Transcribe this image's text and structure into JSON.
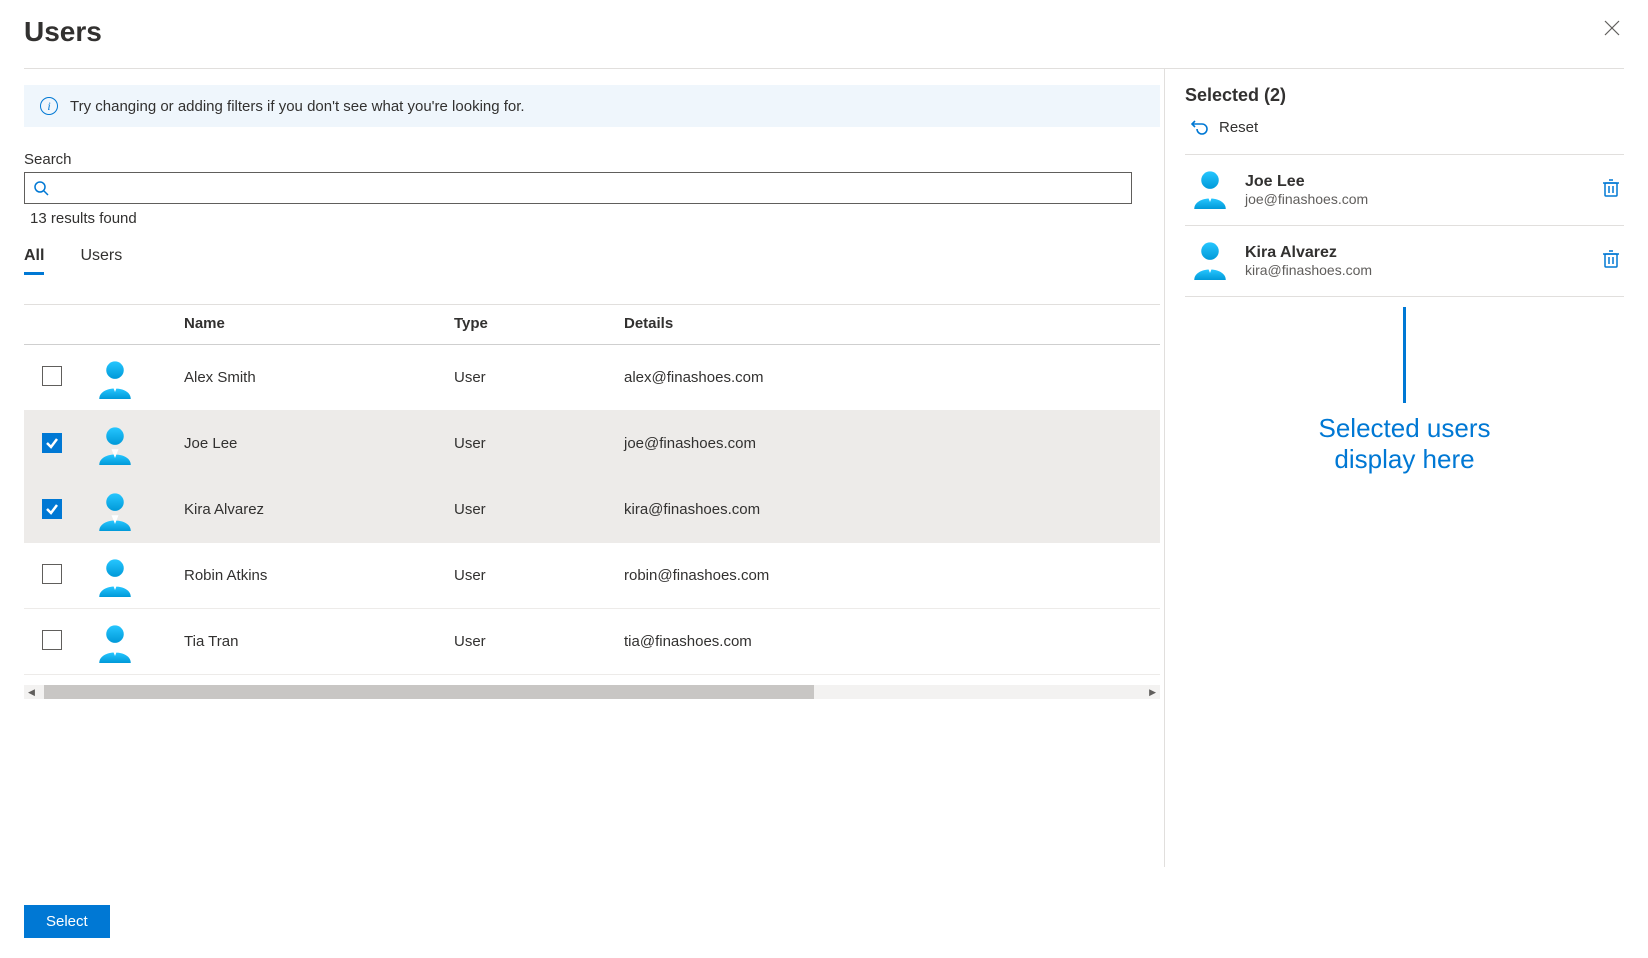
{
  "pageTitle": "Users",
  "infoBanner": "Try changing or adding filters if you don't see what you're looking for.",
  "searchLabel": "Search",
  "resultsCount": "13 results found",
  "tabs": {
    "all": "All",
    "users": "Users"
  },
  "columns": {
    "name": "Name",
    "type": "Type",
    "details": "Details"
  },
  "rows": [
    {
      "name": "Alex Smith",
      "type": "User",
      "details": "alex@finashoes.com",
      "checked": false
    },
    {
      "name": "Joe Lee",
      "type": "User",
      "details": "joe@finashoes.com",
      "checked": true
    },
    {
      "name": "Kira Alvarez",
      "type": "User",
      "details": "kira@finashoes.com",
      "checked": true
    },
    {
      "name": "Robin Atkins",
      "type": "User",
      "details": "robin@finashoes.com",
      "checked": false
    },
    {
      "name": "Tia Tran",
      "type": "User",
      "details": "tia@finashoes.com",
      "checked": false
    }
  ],
  "selectButton": "Select",
  "selectedHeader": "Selected (2)",
  "resetLabel": "Reset",
  "selectedItems": [
    {
      "name": "Joe Lee",
      "email": "joe@finashoes.com"
    },
    {
      "name": "Kira Alvarez",
      "email": "kira@finashoes.com"
    }
  ],
  "callout": {
    "line1": "Selected users",
    "line2": "display here"
  }
}
